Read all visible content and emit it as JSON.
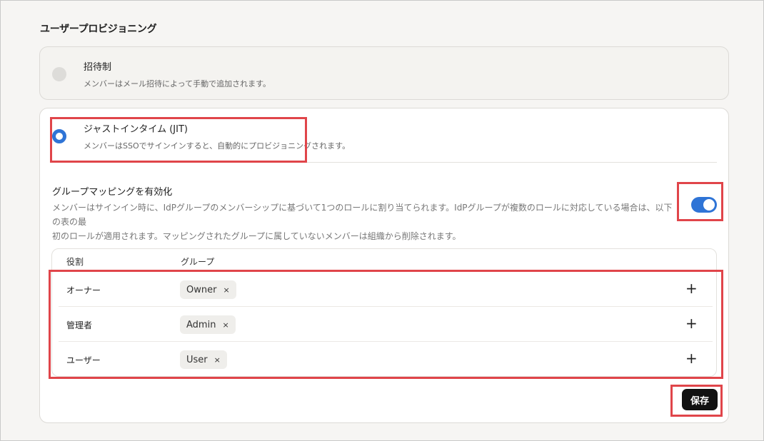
{
  "section_title": "ユーザープロビジョニング",
  "invite": {
    "title": "招待制",
    "description": "メンバーはメール招待によって手動で追加されます。"
  },
  "jit": {
    "title": "ジャストインタイム (JIT)",
    "description": "メンバーはSSOでサインインすると、自動的にプロビジョニングされます。"
  },
  "group_mapping": {
    "title": "グループマッピングを有効化",
    "description_line1": "メンバーはサインイン時に、IdPグループのメンバーシップに基づいて1つのロールに割り当てられます。IdPグループが複数のロールに対応している場合は、以下の表の最",
    "description_line2": "初のロールが適用されます。マッピングされたグループに属していないメンバーは組織から削除されます。",
    "enabled": true
  },
  "table": {
    "headers": {
      "role": "役割",
      "group": "グループ"
    },
    "rows": [
      {
        "role": "オーナー",
        "group": "Owner",
        "remove": "×",
        "add": "+"
      },
      {
        "role": "管理者",
        "group": "Admin",
        "remove": "×",
        "add": "+"
      },
      {
        "role": "ユーザー",
        "group": "User",
        "remove": "×",
        "add": "+"
      }
    ]
  },
  "save_label": "保存",
  "colors": {
    "accent": "#2f74d6",
    "highlight": "#e0454a",
    "save_button": "#111111"
  }
}
